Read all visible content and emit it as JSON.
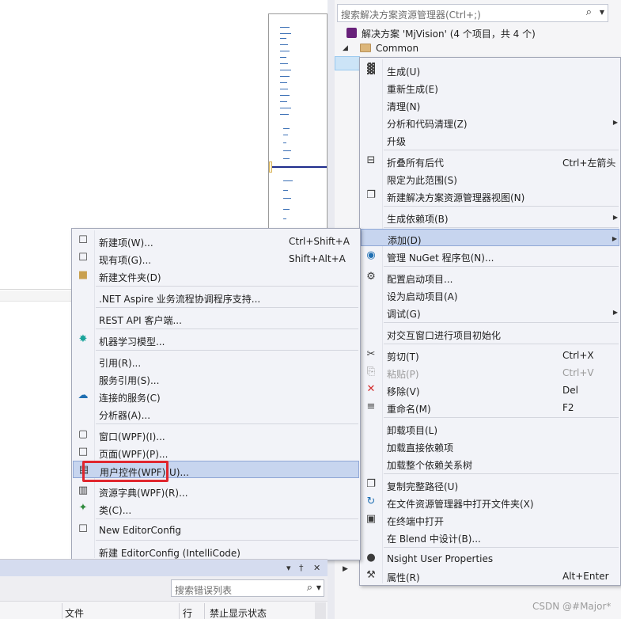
{
  "solution_explorer": {
    "search_placeholder": "搜索解决方案资源管理器(Ctrl+;)",
    "solution_label": "解决方案 'MjVision' (4 个项目，共 4 个)",
    "common_folder": "Common"
  },
  "context_menu": {
    "build": "生成(U)",
    "rebuild": "重新生成(E)",
    "clean": "清理(N)",
    "analyze": "分析和代码清理(Z)",
    "upgrade": "升级",
    "collapse_all": "折叠所有后代",
    "collapse_all_shortcut": "Ctrl+左箭头",
    "scope_to_this": "限定为此范围(S)",
    "new_se_view": "新建解决方案资源管理器视图(N)",
    "build_dependencies": "生成依赖项(B)",
    "add": "添加(D)",
    "manage_nuget": "管理 NuGet 程序包(N)...",
    "configure_startup": "配置启动项目...",
    "set_startup": "设为启动项目(A)",
    "debug": "调试(G)",
    "init_interactive": "对交互窗口进行项目初始化",
    "cut": "剪切(T)",
    "cut_shortcut": "Ctrl+X",
    "paste": "粘贴(P)",
    "paste_shortcut": "Ctrl+V",
    "remove": "移除(V)",
    "remove_shortcut": "Del",
    "rename": "重命名(M)",
    "rename_shortcut": "F2",
    "unload": "卸载项目(L)",
    "load_direct": "加载直接依赖项",
    "load_tree": "加载整个依赖关系树",
    "copy_path": "复制完整路径(U)",
    "open_in_explorer": "在文件资源管理器中打开文件夹(X)",
    "open_in_terminal": "在终端中打开",
    "design_in_blend": "在 Blend 中设计(B)...",
    "nsight": "Nsight User Properties",
    "properties": "属性(R)",
    "properties_shortcut": "Alt+Enter"
  },
  "add_submenu": {
    "new_item": "新建项(W)...",
    "new_item_shortcut": "Ctrl+Shift+A",
    "existing_item": "现有项(G)...",
    "existing_item_shortcut": "Shift+Alt+A",
    "new_folder": "新建文件夹(D)",
    "aspire": ".NET Aspire 业务流程协调程序支持...",
    "rest_api": "REST API 客户端...",
    "ml_model": "机器学习模型...",
    "reference": "引用(R)...",
    "service_reference": "服务引用(S)...",
    "connected_service": "连接的服务(C)",
    "analyzer": "分析器(A)...",
    "window_wpf": "窗口(WPF)(I)...",
    "page_wpf": "页面(WPF)(P)...",
    "user_control_wpf": "用户控件(WPF)(U)...",
    "resource_dict": "资源字典(WPF)(R)...",
    "class": "类(C)...",
    "new_editorconfig": "New EditorConfig",
    "new_editorconfig_ic": "新建 EditorConfig (IntelliCode)"
  },
  "error_list": {
    "search_placeholder": "搜索错误列表",
    "col_file": "文件",
    "col_line": "行",
    "col_suppress": "禁止显示状态"
  },
  "watermark": "CSDN @#Major*",
  "colors": {
    "highlight": "#c7d5ef",
    "red_box": "#e0262e",
    "menu_bg": "#f2f3f8"
  }
}
